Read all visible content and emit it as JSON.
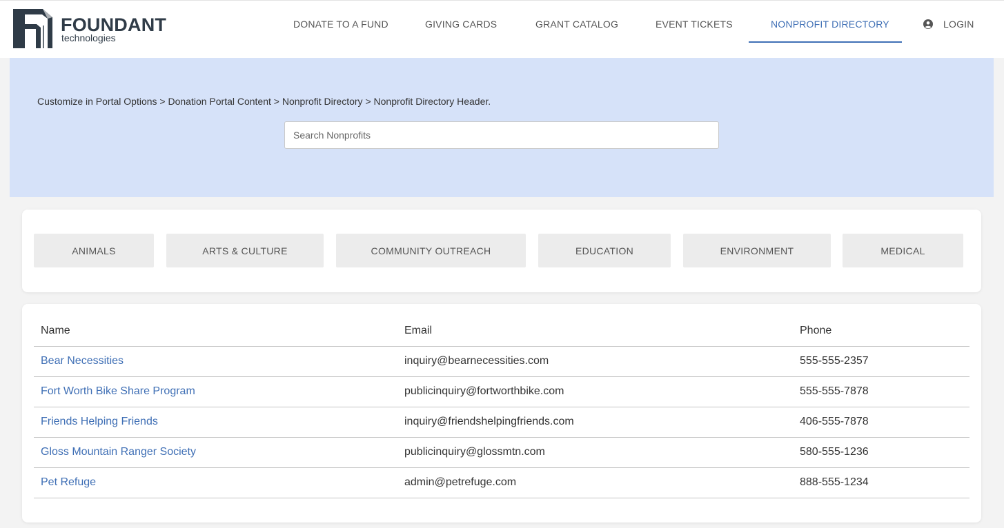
{
  "brand": {
    "name": "FOUNDANT",
    "sub": "technologies",
    "logo_icon": "foundant-logo-icon",
    "color": "#2f3b47"
  },
  "nav": {
    "items": [
      {
        "label": "DONATE TO A FUND",
        "active": false
      },
      {
        "label": "GIVING CARDS",
        "active": false
      },
      {
        "label": "GRANT CATALOG",
        "active": false
      },
      {
        "label": "EVENT TICKETS",
        "active": false
      },
      {
        "label": "NONPROFIT DIRECTORY",
        "active": true
      }
    ],
    "login_label": "LOGIN",
    "login_icon": "user-circle-icon",
    "active_color": "#3f6fb5"
  },
  "hero": {
    "text": "Customize in Portal Options > Donation Portal Content > Nonprofit Directory > Nonprofit Directory Header.",
    "background": "#d6e2f9",
    "search_placeholder": "Search Nonprofits",
    "search_value": ""
  },
  "categories": [
    "ANIMALS",
    "ARTS & CULTURE",
    "COMMUNITY OUTREACH",
    "EDUCATION",
    "ENVIRONMENT",
    "MEDICAL"
  ],
  "table": {
    "headers": [
      "Name",
      "Email",
      "Phone"
    ],
    "rows": [
      {
        "name": "Bear Necessities",
        "email": "inquiry@bearnecessities.com",
        "phone": "555-555-2357"
      },
      {
        "name": "Fort Worth Bike Share Program",
        "email": "publicinquiry@fortworthbike.com",
        "phone": "555-555-7878"
      },
      {
        "name": "Friends Helping Friends",
        "email": "inquiry@friendshelpingfriends.com",
        "phone": "406-555-7878"
      },
      {
        "name": "Gloss Mountain Ranger Society",
        "email": "publicinquiry@glossmtn.com",
        "phone": "580-555-1236"
      },
      {
        "name": "Pet Refuge",
        "email": "admin@petrefuge.com",
        "phone": "888-555-1234"
      }
    ]
  }
}
